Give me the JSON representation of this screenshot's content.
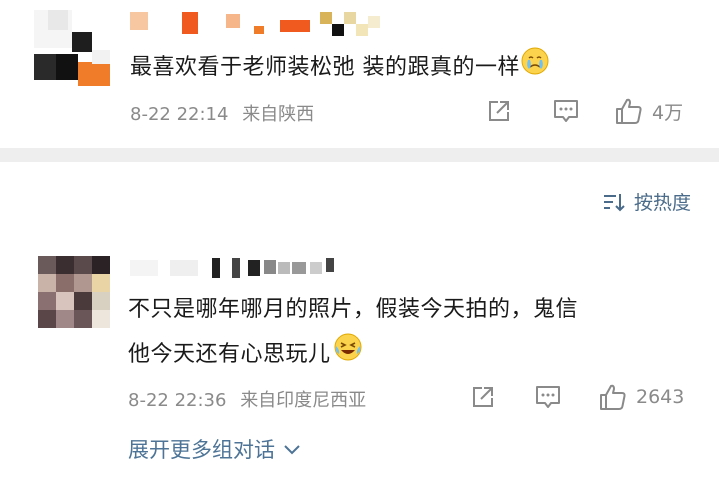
{
  "comments": [
    {
      "text": "最喜欢看于老师装松弛 装的跟真的一样",
      "emoji": "crying-face-emoji",
      "date_time": "8-22 22:14",
      "location": "来自陕西",
      "likes": "4万"
    },
    {
      "text_line1": "不只是哪年哪月的照片，假装今天拍的，鬼信",
      "text_line2": "他今天还有心思玩儿",
      "emoji": "laughing-tears-emoji",
      "date_time": "8-22 22:36",
      "location": "来自印度尼西亚",
      "likes": "2643"
    }
  ],
  "sort_label": "按热度",
  "expand_label": "展开更多组对话",
  "colors": {
    "link": "#4d7496",
    "meta": "#8a8a8a",
    "divider": "#eeeeee",
    "accent_orange": "#f07c2a"
  }
}
